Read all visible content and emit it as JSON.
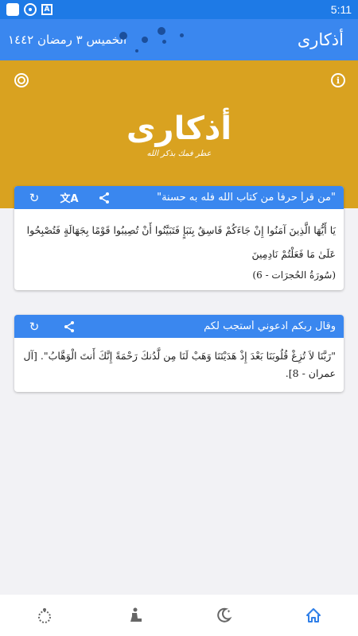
{
  "status_bar": {
    "time": "5:11",
    "icons": [
      "square-icon",
      "shutter-icon",
      "a-box-icon"
    ]
  },
  "app_bar": {
    "title": "أذكارى",
    "date": "الخميس ٣ رمضان ١٤٤٢"
  },
  "hero": {
    "logo_text": "أذكارى",
    "logo_subtitle": "عطر فمك بذكر الله",
    "icons": [
      "info-icon",
      "settings-icon"
    ]
  },
  "card1": {
    "title": "\"من قرأ حرفاً من كتاب الله فله به حسنة\"",
    "verse": "يَا أَيُّهَا الَّذِينَ آمَنُوا إِنْ جَاءَكُمْ فَاسِقٌ بِنَبَإٍ فَتَبَيَّنُوا أَنْ تُصِيبُوا قَوْمًا بِجَهَالَةٍ فَتُصْبِحُوا عَلَىٰ مَا فَعَلْتُمْ نَادِمِينَ",
    "source": "(سُورَةُ الحُجرَات - 6)",
    "actions": [
      "share-icon",
      "translate-icon",
      "refresh-icon"
    ]
  },
  "card2": {
    "title": "وقال ربكم ادعوني أستجب لكم",
    "dua": "\"رَبَّنَا لاَ تُزِغْ قُلُوبَنَا بَعْدَ إِذْ هَدَيْتَنَا وَهَبْ لَنَا مِن لَّدُنكَ رَحْمَةً إِنَّكَ أَنتَ الْوَهَّابُ\". [آل عمران - 8].",
    "actions": [
      "share-icon",
      "refresh-icon"
    ]
  },
  "bottom_nav": {
    "items": [
      "home-icon",
      "moon-icon",
      "prayer-icon",
      "prayer-beads-icon"
    ],
    "active": "home-icon"
  },
  "colors": {
    "primary": "#3a87ef",
    "status_bar": "#1e7ae6",
    "hero": "#d9a220",
    "verse_highlight": "#c0392b"
  }
}
